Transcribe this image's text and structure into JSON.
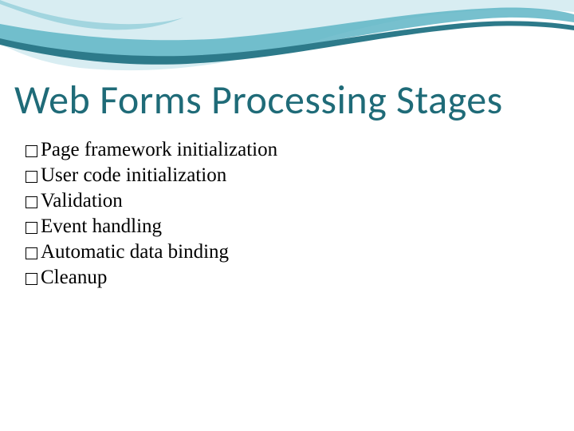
{
  "title": "Web Forms Processing Stages",
  "bullets": [
    {
      "text": "Page framework initialization"
    },
    {
      "text": "User code initialization"
    },
    {
      "text": "Validation"
    },
    {
      "text": "Event handling"
    },
    {
      "text": "Automatic data binding"
    },
    {
      "text": "Cleanup"
    }
  ],
  "colors": {
    "title": "#1f6b78",
    "wave_light": "#a8d8e0",
    "wave_mid": "#5fb5c5",
    "wave_dark": "#3a8fa0"
  }
}
